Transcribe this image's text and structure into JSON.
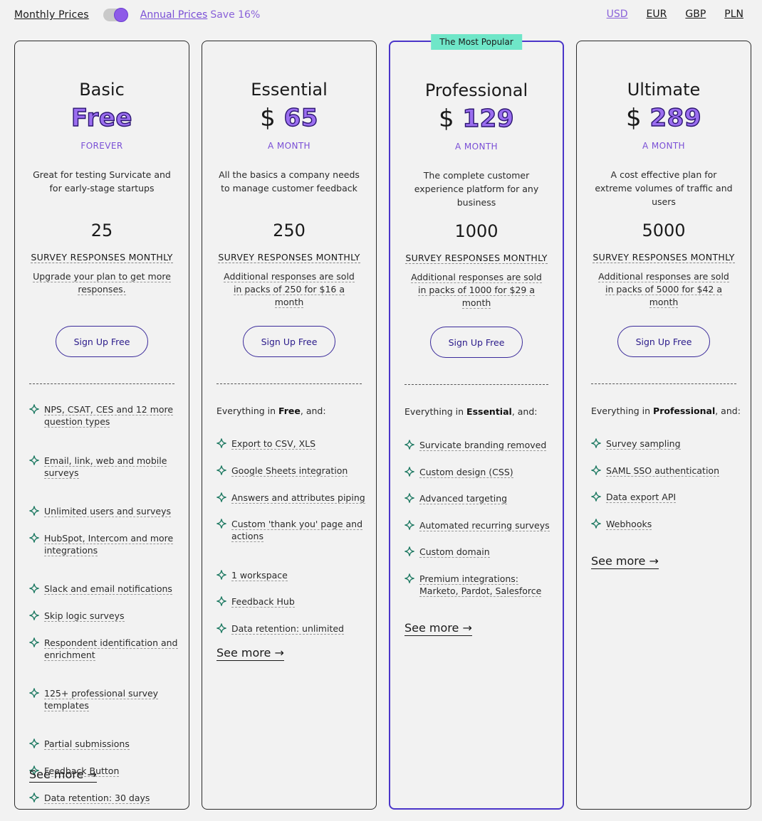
{
  "billing": {
    "monthly_label": "Monthly Prices",
    "annual_label": "Annual Prices",
    "save_label": "Save 16%"
  },
  "currencies": [
    "USD",
    "EUR",
    "GBP",
    "PLN"
  ],
  "active_currency": "USD",
  "colors": {
    "accent": "#9b6ef0",
    "badge": "#6fe6c8",
    "sparkle": "#1f7a63",
    "popular_border": "#4a35c9"
  },
  "plans": [
    {
      "name": "Basic",
      "currency_sign": "",
      "price": "Free",
      "period": "FOREVER",
      "description": "Great for testing Survicate and for early-stage startups",
      "responses": "25",
      "responses_label": "SURVEY RESPONSES MONTHLY",
      "extra": "Upgrade your plan to get more responses.",
      "cta": "Sign Up Free",
      "intro_prefix": "",
      "intro_bold": "",
      "intro_suffix": "",
      "features": [
        "NPS, CSAT, CES and 12 more question types",
        "Email, link, web and mobile surveys",
        "Unlimited users and surveys",
        "HubSpot, Intercom and more integrations",
        "Slack and email notifications",
        "Skip logic surveys",
        "Respondent identification and enrichment",
        "125+ professional survey templates",
        "Partial submissions",
        "Feedback Button",
        "Data retention: 30 days"
      ],
      "see_more": "See more →"
    },
    {
      "name": "Essential",
      "currency_sign": "$",
      "price": "65",
      "period": "A MONTH",
      "description": "All the basics a company needs to manage customer feedback",
      "responses": "250",
      "responses_label": "SURVEY RESPONSES MONTHLY",
      "extra": "Additional responses are sold in packs of 250 for $16 a month",
      "cta": "Sign Up Free",
      "intro_prefix": "Everything in ",
      "intro_bold": "Free",
      "intro_suffix": ", and:",
      "features": [
        "Export to CSV, XLS",
        "Google Sheets integration",
        "Answers and attributes piping",
        "Custom 'thank you' page and actions",
        "1 workspace",
        "Feedback Hub",
        "Data retention: unlimited"
      ],
      "see_more": "See more →"
    },
    {
      "name": "Professional",
      "badge": "The Most Popular",
      "currency_sign": "$",
      "price": "129",
      "period": "A MONTH",
      "description": "The complete customer experience platform for any business",
      "responses": "1000",
      "responses_label": "SURVEY RESPONSES MONTHLY",
      "extra": "Additional responses are sold in packs of 1000 for $29 a month",
      "cta": "Sign Up Free",
      "intro_prefix": "Everything in ",
      "intro_bold": "Essential",
      "intro_suffix": ", and:",
      "features": [
        "Survicate branding removed",
        "Custom design (CSS)",
        "Advanced targeting",
        "Automated recurring surveys",
        "Custom domain",
        "Premium integrations: Marketo, Pardot, Salesforce"
      ],
      "see_more": "See more →"
    },
    {
      "name": "Ultimate",
      "currency_sign": "$",
      "price": "289",
      "period": "A MONTH",
      "description": "A cost effective plan for extreme volumes of traffic and users",
      "responses": "5000",
      "responses_label": "SURVEY RESPONSES MONTHLY",
      "extra": "Additional responses are sold in packs of 5000 for $42 a month",
      "cta": "Sign Up Free",
      "intro_prefix": "Everything in ",
      "intro_bold": "Professional",
      "intro_suffix": ", and:",
      "features": [
        "Survey sampling",
        "SAML SSO authentication",
        "Data export API",
        "Webhooks"
      ],
      "see_more": "See more →"
    }
  ]
}
